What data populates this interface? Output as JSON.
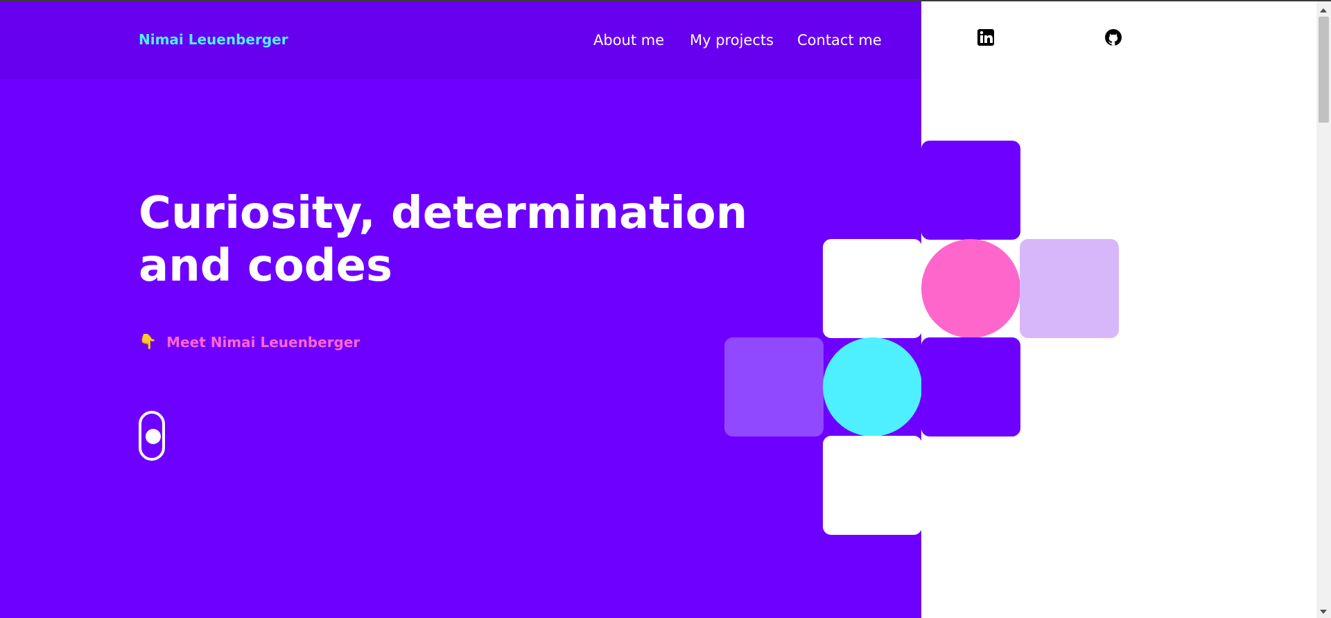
{
  "header": {
    "brand": "Nimai Leuenberger",
    "nav": [
      "About me",
      "My projects",
      "Contact me"
    ],
    "social": [
      {
        "name": "linkedin-icon",
        "label": "LinkedIn"
      },
      {
        "name": "github-icon",
        "label": "GitHub"
      }
    ]
  },
  "hero": {
    "title": "Curiosity, determination and codes",
    "meet_label": "Meet Nimai Leuenberger",
    "meet_icon": "pointing-down-hand-icon"
  },
  "colors": {
    "accent": "#6e00ff",
    "brand_text": "#4ef0ff",
    "pink": "#ff66cc",
    "lilac": "#d7b7f9",
    "purple_soft": "#9149ff",
    "cyan": "#4ef0ff"
  }
}
